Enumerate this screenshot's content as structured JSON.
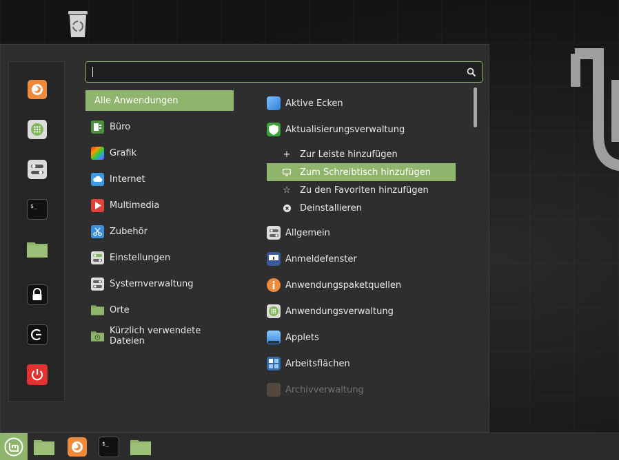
{
  "search": {
    "value": "",
    "placeholder": ""
  },
  "categories": [
    {
      "label": "Alle Anwendungen",
      "icon": "none",
      "active": true
    },
    {
      "label": "Büro",
      "icon": "office-icon"
    },
    {
      "label": "Grafik",
      "icon": "graphics-icon"
    },
    {
      "label": "Internet",
      "icon": "internet-icon"
    },
    {
      "label": "Multimedia",
      "icon": "multimedia-icon"
    },
    {
      "label": "Zubehör",
      "icon": "accessories-icon"
    },
    {
      "label": "Einstellungen",
      "icon": "settings-icon"
    },
    {
      "label": "Systemverwaltung",
      "icon": "administration-icon"
    },
    {
      "label": "Orte",
      "icon": "places-folder-icon"
    },
    {
      "label": "Kürzlich verwendete Dateien",
      "icon": "recent-files-icon"
    }
  ],
  "apps_top": [
    {
      "label": "Aktive Ecken",
      "icon": "hot-corners-icon"
    },
    {
      "label": "Aktualisierungsverwaltung",
      "icon": "update-manager-icon"
    }
  ],
  "context_menu": [
    {
      "label": "Zur Leiste hinzufügen",
      "icon": "plus-icon"
    },
    {
      "label": "Zum Schreibtisch hinzufügen",
      "icon": "desktop-icon",
      "active": true
    },
    {
      "label": "Zu den Favoriten hinzufügen",
      "icon": "star-icon"
    },
    {
      "label": "Deinstallieren",
      "icon": "remove-icon"
    }
  ],
  "apps_bottom": [
    {
      "label": "Allgemein",
      "icon": "general-settings-icon"
    },
    {
      "label": "Anmeldefenster",
      "icon": "login-window-icon"
    },
    {
      "label": "Anwendungspaketquellen",
      "icon": "software-sources-icon"
    },
    {
      "label": "Anwendungsverwaltung",
      "icon": "software-manager-icon"
    },
    {
      "label": "Applets",
      "icon": "applets-icon"
    },
    {
      "label": "Arbeitsflächen",
      "icon": "workspaces-icon"
    },
    {
      "label": "Archivverwaltung",
      "icon": "archive-manager-icon"
    }
  ],
  "favorites": [
    "firefox-icon",
    "software-manager-icon",
    "settings-icon",
    "terminal-icon",
    "files-folder-icon",
    "lock-icon",
    "logout-icon",
    "power-icon"
  ],
  "taskbar": [
    "mint-menu-icon",
    "files-folder-icon",
    "firefox-icon",
    "terminal-icon",
    "files-folder-icon"
  ],
  "colors": {
    "accent": "#8fb46b",
    "menu_bg": "#2e2e2e",
    "panel_bg": "#2b2b2b"
  }
}
